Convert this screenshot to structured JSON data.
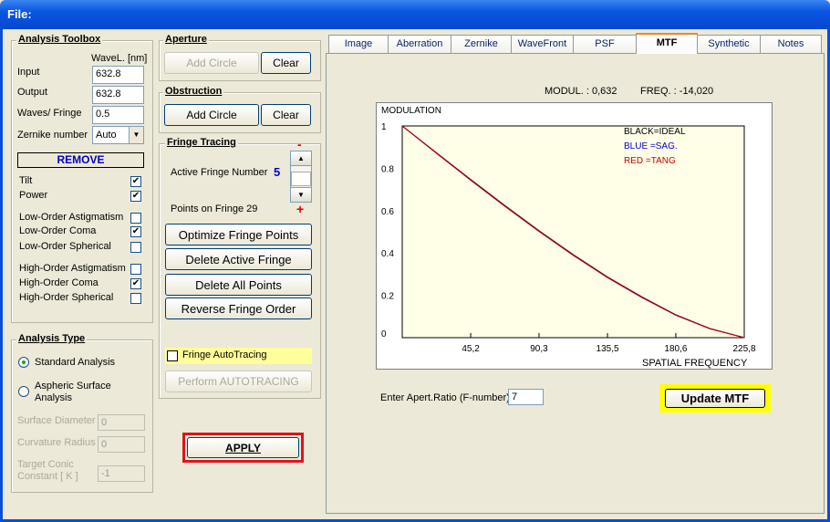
{
  "window": {
    "title": "File:"
  },
  "toolbox": {
    "title": "Analysis Toolbox",
    "wavel_header": "WaveL. [nm]",
    "input_label": "Input",
    "input_value": "632.8",
    "output_label": "Output",
    "output_value": "632.8",
    "waves_label": "Waves/ Fringe",
    "waves_value": "0.5",
    "zernike_label": "Zernike number",
    "zernike_value": "Auto",
    "remove_label": "REMOVE",
    "terms": [
      {
        "label": "Tilt",
        "checked": true
      },
      {
        "label": "Power",
        "checked": true
      },
      {
        "label": "Low-Order  Astigmatism",
        "checked": false
      },
      {
        "label": "Low-Order  Coma",
        "checked": true
      },
      {
        "label": "Low-Order  Spherical",
        "checked": false
      },
      {
        "label": "High-Order  Astigmatism",
        "checked": false
      },
      {
        "label": "High-Order  Coma",
        "checked": true
      },
      {
        "label": "High-Order  Spherical",
        "checked": false
      }
    ]
  },
  "analysis_type": {
    "title": "Analysis Type",
    "standard_label": "Standard  Analysis",
    "aspheric_label_1": "Aspheric  Surface",
    "aspheric_label_2": "Analysis",
    "surface_diameter_label": "Surface Diameter",
    "surface_diameter_value": "0",
    "curvature_radius_label": "Curvature Radius",
    "curvature_radius_value": "0",
    "target_conic_label_1": "Target Conic",
    "target_conic_label_2": "Constant [ K ]",
    "target_conic_value": "-1"
  },
  "aperture": {
    "title": "Aperture",
    "add_label": "Add Circle",
    "clear_label": "Clear"
  },
  "obstruction": {
    "title": "Obstruction",
    "add_label": "Add Circle",
    "clear_label": "Clear"
  },
  "fringe": {
    "title": "Fringe Tracing",
    "active_label": "Active Fringe Number",
    "active_value": "5",
    "points_label": "Points on  Fringe 29",
    "minus": "-",
    "plus": "+",
    "optimize_label": "Optimize Fringe Points",
    "delete_active_label": "Delete Active Fringe",
    "delete_all_label": "Delete  All  Points",
    "reverse_label": "Reverse  Fringe Order",
    "autotracing_label": "Fringe AutoTracing",
    "perform_label": "Perform  AUTOTRACING"
  },
  "apply_label": "APPLY",
  "tabs": [
    "Image",
    "Aberration",
    "Zernike",
    "WaveFront",
    "PSF",
    "MTF",
    "Synthetic",
    "Notes"
  ],
  "mtf": {
    "modul_text": "MODUL. :  0,632",
    "freq_text": "FREQ. :  -14,020",
    "f_label": "Enter Apert.Ratio (F-number)",
    "f_value": "7",
    "update_label": "Update MTF"
  },
  "chart_data": {
    "type": "line",
    "ylabel": "MODULATION",
    "xlabel": "SPATIAL FREQUENCY",
    "ylim": [
      0,
      1
    ],
    "xlim": [
      0,
      225.8
    ],
    "x_ticks": [
      "45,2",
      "90,3",
      "135,5",
      "180,6",
      "225,8"
    ],
    "y_ticks": [
      "0",
      "0.2",
      "0.4",
      "0.6",
      "0.8",
      "1"
    ],
    "legend": [
      {
        "text": "BLACK=IDEAL",
        "color": "#000000"
      },
      {
        "text": "BLUE  =SAG.",
        "color": "#0000cc"
      },
      {
        "text": "RED    =TANG",
        "color": "#cc0000"
      }
    ],
    "grid": false,
    "background": "#ffffe8",
    "series": [
      {
        "name": "IDEAL",
        "color": "#000000",
        "x": [
          0,
          22.6,
          45.2,
          67.7,
          90.3,
          112.9,
          135.5,
          158.1,
          180.6,
          203.2,
          225.8
        ],
        "values": [
          1.0,
          0.873,
          0.747,
          0.624,
          0.505,
          0.392,
          0.287,
          0.193,
          0.108,
          0.043,
          0.0
        ]
      },
      {
        "name": "SAG.",
        "color": "#0000cc",
        "x": [
          0,
          22.6,
          45.2,
          67.7,
          90.3,
          112.9,
          135.5,
          158.1,
          180.6,
          203.2,
          225.8
        ],
        "values": [
          1.0,
          0.871,
          0.744,
          0.621,
          0.502,
          0.389,
          0.284,
          0.19,
          0.106,
          0.042,
          0.0
        ]
      },
      {
        "name": "TANG",
        "color": "#cc0000",
        "x": [
          0,
          22.6,
          45.2,
          67.7,
          90.3,
          112.9,
          135.5,
          158.1,
          180.6,
          203.2,
          225.8
        ],
        "values": [
          1.0,
          0.872,
          0.745,
          0.622,
          0.503,
          0.39,
          0.285,
          0.191,
          0.107,
          0.042,
          0.0
        ]
      }
    ]
  }
}
